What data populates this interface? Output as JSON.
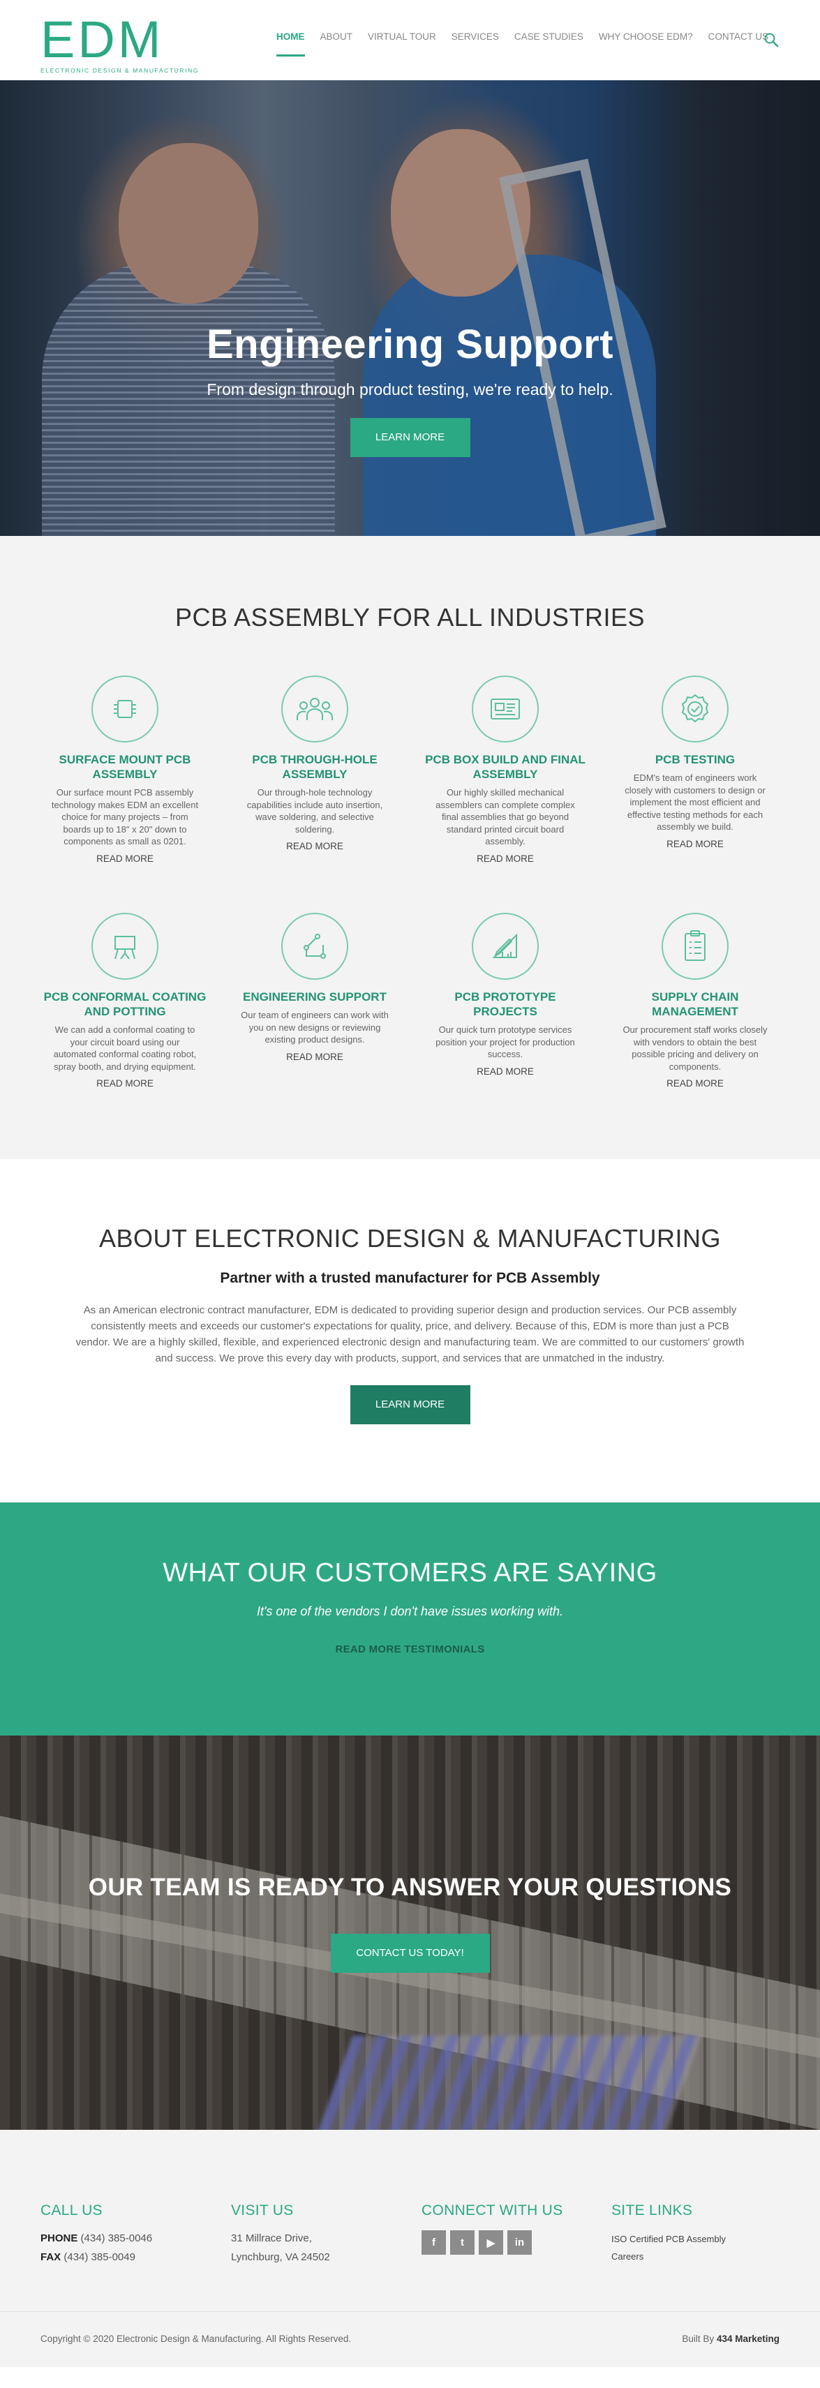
{
  "brand": {
    "logo_text": "EDM",
    "logo_sub": "ELECTRONIC DESIGN & MANUFACTURING",
    "accent_color": "#2ba884"
  },
  "nav": {
    "items": [
      {
        "label": "HOME",
        "active": true
      },
      {
        "label": "ABOUT"
      },
      {
        "label": "VIRTUAL TOUR"
      },
      {
        "label": "SERVICES"
      },
      {
        "label": "CASE STUDIES"
      },
      {
        "label": "WHY CHOOSE EDM?"
      },
      {
        "label": "CONTACT US"
      }
    ],
    "search_icon": "search-icon"
  },
  "hero": {
    "title": "Engineering Support",
    "subtitle": "From design through product testing, we're ready to help.",
    "button": "LEARN MORE"
  },
  "services": {
    "title": "PCB ASSEMBLY FOR ALL INDUSTRIES",
    "items": [
      {
        "icon": "chip-icon",
        "title": "SURFACE MOUNT PCB ASSEMBLY",
        "desc": "Our surface mount PCB assembly technology makes EDM an excellent choice for many projects – from boards up to 18\" x 20\" down to components as small as 0201.",
        "link": "READ MORE"
      },
      {
        "icon": "team-icon",
        "title": "PCB THROUGH-HOLE ASSEMBLY",
        "desc": "Our through-hole technology capabilities include auto insertion, wave soldering, and selective soldering.",
        "link": "READ MORE"
      },
      {
        "icon": "box-build-icon",
        "title": "PCB BOX BUILD AND FINAL ASSEMBLY",
        "desc": "Our highly skilled mechanical assemblers can complete complex final assemblies that go beyond standard printed circuit board assembly.",
        "link": "READ MORE"
      },
      {
        "icon": "badge-check-icon",
        "title": "PCB TESTING",
        "desc": "EDM's team of engineers work closely with customers to design or implement the most efficient and effective testing methods for each assembly we build.",
        "link": "READ MORE"
      },
      {
        "icon": "presentation-icon",
        "title": "PCB CONFORMAL COATING AND POTTING",
        "desc": "We can add a conformal coating to your circuit board using our automated conformal coating robot, spray booth, and drying equipment.",
        "link": "READ MORE"
      },
      {
        "icon": "flow-icon",
        "title": "ENGINEERING SUPPORT",
        "desc": "Our team of engineers can work with you on new designs or reviewing existing product designs.",
        "link": "READ MORE"
      },
      {
        "icon": "ruler-pencil-icon",
        "title": "PCB PROTOTYPE PROJECTS",
        "desc": "Our quick turn prototype services position your project for production success.",
        "link": "READ MORE"
      },
      {
        "icon": "clipboard-icon",
        "title": "SUPPLY CHAIN MANAGEMENT",
        "desc": "Our procurement staff works closely with vendors to obtain the best possible pricing and delivery on components.",
        "link": "READ MORE"
      }
    ]
  },
  "about": {
    "title": "ABOUT ELECTRONIC DESIGN & MANUFACTURING",
    "subtitle": "Partner with a trusted manufacturer for PCB Assembly",
    "text": "As an American electronic contract manufacturer, EDM is dedicated to providing superior design and production services. Our PCB assembly consistently meets and exceeds our customer's expectations for quality, price, and delivery. Because of this, EDM is more than just a PCB vendor. We are a highly skilled, flexible, and experienced electronic design and manufacturing team. We are committed to our customers' growth and success. We prove this every day with products, support, and services that are unmatched in the industry.",
    "button": "LEARN MORE"
  },
  "testimonials": {
    "title": "WHAT OUR CUSTOMERS ARE SAYING",
    "quote": "It's one of the vendors I don't have issues working with.",
    "link": "READ MORE TESTIMONIALS"
  },
  "cta": {
    "title": "OUR TEAM IS READY TO ANSWER YOUR QUESTIONS",
    "button": "CONTACT US TODAY!"
  },
  "footer": {
    "call": {
      "title": "CALL US",
      "phone_label": "PHONE",
      "phone": "(434) 385-0046",
      "fax_label": "FAX",
      "fax": "(434) 385-0049"
    },
    "visit": {
      "title": "VISIT US",
      "line1": "31 Millrace Drive,",
      "line2": "Lynchburg, VA 24502"
    },
    "connect": {
      "title": "CONNECT WITH US",
      "icons": [
        "facebook-icon",
        "twitter-icon",
        "youtube-icon",
        "linkedin-icon"
      ],
      "glyphs": [
        "f",
        "t",
        "▶",
        "in"
      ]
    },
    "site_links": {
      "title": "SITE LINKS",
      "links": [
        "ISO Certified PCB Assembly",
        "Careers"
      ]
    }
  },
  "bottom": {
    "copyright": "Copyright © 2020 Electronic Design & Manufacturing. All Rights Reserved.",
    "built_by_label": "Built By",
    "built_by": "434 Marketing"
  }
}
